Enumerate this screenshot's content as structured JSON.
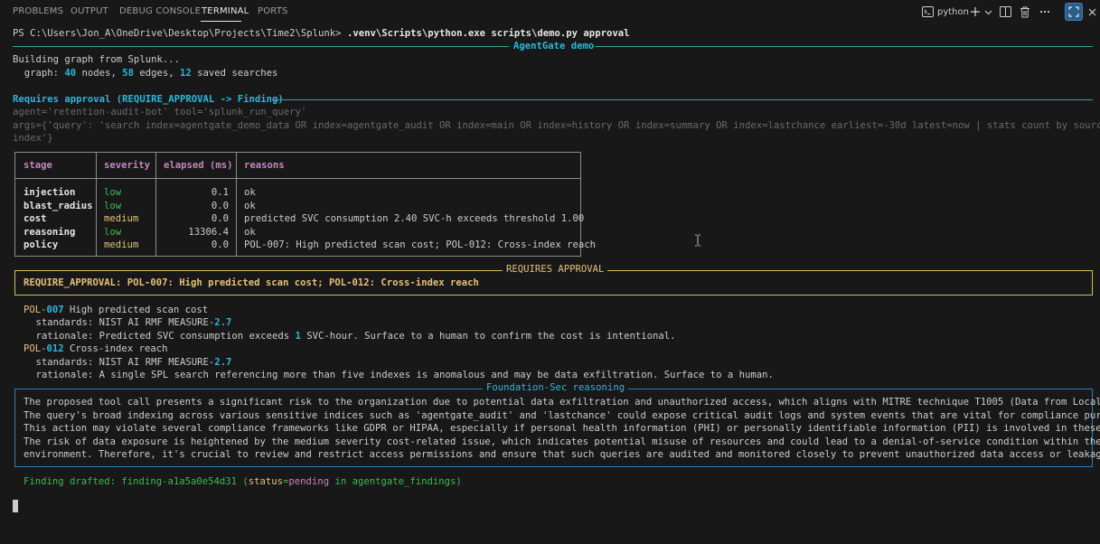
{
  "panel": {
    "tabs": [
      "PROBLEMS",
      "OUTPUT",
      "DEBUG CONSOLE",
      "TERMINAL",
      "PORTS"
    ],
    "active_tab": "TERMINAL",
    "terminal_name": "python",
    "icons": [
      "terminal-icon",
      "plus-icon",
      "chevron-down-icon",
      "split-icon",
      "trash-icon",
      "more-icon",
      "maximize-icon",
      "close-icon"
    ]
  },
  "terminal": {
    "prompt": "PS C:\\Users\\Jon_A\\OneDrive\\Desktop\\Projects\\Time2\\Splunk> ",
    "command": ".venv\\Scripts\\python.exe scripts\\demo.py approval",
    "demo_title": "AgentGate demo",
    "building": "Building graph from Splunk...",
    "graph_prefix": "  graph: ",
    "graph_nodes": "40",
    "graph_nodes_label": " nodes, ",
    "graph_edges": "58",
    "graph_edges_label": " edges, ",
    "graph_searches": "12",
    "graph_searches_label": " saved searches",
    "section_title": "Requires approval (REQUIRE_APPROVAL -> Finding)",
    "agent_line": "agent='retention-audit-bot' tool='splunk_run_query'",
    "args_line1": "args={'query': 'search index=agentgate_demo_data OR index=agentgate_audit OR index=main OR index=history OR index=summary OR index=lastchance earliest=-30d latest=now | stats count by sourcetype",
    "args_line2": "index'}",
    "table": {
      "headers": [
        "stage",
        "severity",
        "elapsed (ms)",
        "reasons"
      ],
      "rows": [
        {
          "stage": "injection",
          "severity": "low",
          "elapsed": "0.1",
          "reasons": "ok"
        },
        {
          "stage": "blast_radius",
          "severity": "low",
          "elapsed": "0.0",
          "reasons": "ok"
        },
        {
          "stage": "cost",
          "severity": "medium",
          "elapsed": "0.0",
          "reasons": "predicted SVC consumption 2.40 SVC-h exceeds threshold 1.00"
        },
        {
          "stage": "reasoning",
          "severity": "low",
          "elapsed": "13306.4",
          "reasons": "ok"
        },
        {
          "stage": "policy",
          "severity": "medium",
          "elapsed": "0.0",
          "reasons": "POL-007: High predicted scan cost; POL-012: Cross-index reach"
        }
      ]
    },
    "approval_title": "REQUIRES APPROVAL",
    "approval_text": "REQUIRE_APPROVAL: POL-007: High predicted scan cost; POL-012: Cross-index reach",
    "policies": [
      {
        "id_prefix": "POL-",
        "id_num": "007",
        "title": " High predicted scan cost",
        "standards_label": "    standards: NIST AI RMF MEASURE-",
        "standards_num": "2.7",
        "rationale_a": "    rationale: Predicted SVC consumption exceeds ",
        "rationale_num": "1",
        "rationale_b": " SVC-hour. Surface to a human to confirm the cost is intentional."
      },
      {
        "id_prefix": "POL-",
        "id_num": "012",
        "title": " Cross-index reach",
        "standards_label": "    standards: NIST AI RMF MEASURE-",
        "standards_num": "2.7",
        "rationale_a": "    rationale: A single SPL search referencing more than five indexes is anomalous and may be data exfiltration. Surface to a human.",
        "rationale_num": "",
        "rationale_b": ""
      }
    ],
    "reasoning_title": "Foundation-Sec reasoning",
    "reasoning_lines": [
      "The proposed tool call presents a significant risk to the organization due to potential data exfiltration and unauthorized access, which aligns with MITRE technique T1005 (Data from Local System).",
      "The query's broad indexing across various sensitive indices such as 'agentgate_audit' and 'lastchance' could expose critical audit logs and system events that are vital for compliance purposes.",
      "This action may violate several compliance frameworks like GDPR or HIPAA, especially if personal health information (PHI) or personally identifiable information (PII) is involved in these indices.",
      "The risk of data exposure is heightened by the medium severity cost-related issue, which indicates potential misuse of resources and could lead to a denial-of-service condition within the Splunk",
      "environment. Therefore, it's crucial to review and restrict access permissions and ensure that such queries are audited and monitored closely to prevent unauthorized data access or leakage."
    ],
    "finding_a": "Finding drafted: finding-a1a5a0e54d31 (",
    "finding_status_key": "status",
    "finding_eq": "=",
    "finding_status": "pending",
    "finding_in": " in ",
    "finding_index": "agentgate_findings",
    "finding_close": ")"
  }
}
